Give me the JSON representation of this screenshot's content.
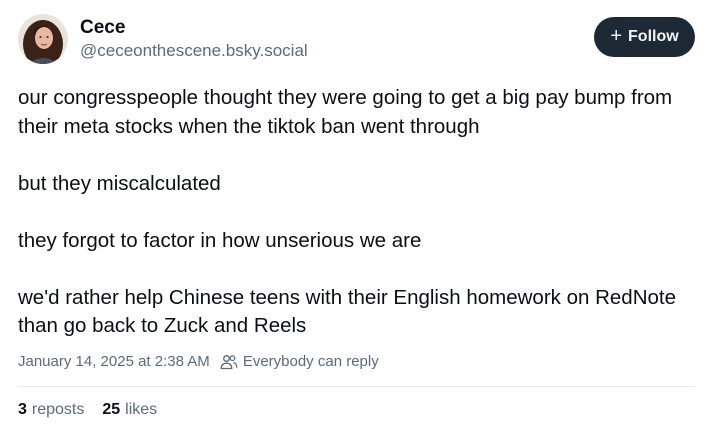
{
  "author": {
    "display_name": "Cece",
    "handle": "@ceceonthescene.bsky.social"
  },
  "follow_button": {
    "label": "Follow"
  },
  "post": {
    "paragraphs": [
      "our congresspeople thought they were going to get a big pay bump from their meta stocks when the tiktok ban went through",
      "but they miscalculated",
      "they forgot to factor in how unserious we are",
      "we'd rather help Chinese teens with their English homework on RedNote than go back to Zuck and Reels"
    ],
    "timestamp": "January 14, 2025 at 2:38 AM",
    "reply_setting": "Everybody can reply"
  },
  "stats": {
    "reposts_count": "3",
    "reposts_label": "reposts",
    "likes_count": "25",
    "likes_label": "likes"
  },
  "icons": {
    "avatar": "avatar-photo",
    "follow": "plus-icon",
    "reply_setting": "people-icon"
  }
}
